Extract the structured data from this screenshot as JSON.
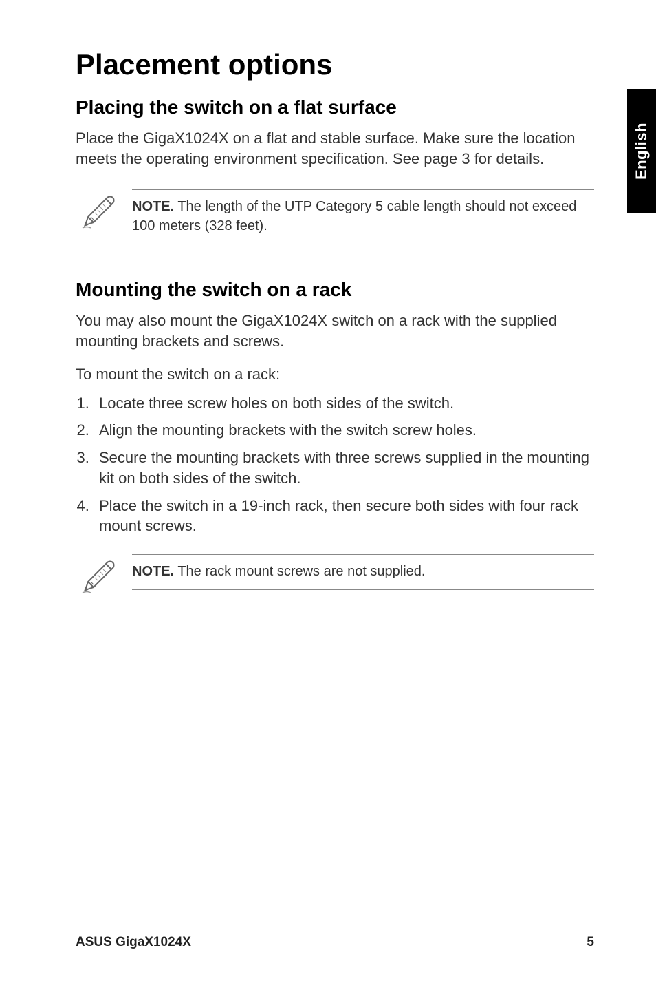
{
  "sideTab": "English",
  "title": "Placement options",
  "section1": {
    "heading": "Placing the switch on a flat surface",
    "paragraph": "Place the GigaX1024X on a flat and stable surface. Make sure the location meets the operating environment specification. See page 3 for details.",
    "noteLabel": "NOTE.",
    "noteText": " The length of the UTP Category 5 cable length should not exceed 100 meters (328 feet)."
  },
  "section2": {
    "heading": "Mounting the switch on a rack",
    "paragraph": "You may also mount the GigaX1024X switch on a rack with the supplied mounting brackets and screws.",
    "leadIn": "To mount the switch on a rack:",
    "steps": [
      "Locate three screw holes on both sides of the switch.",
      "Align the mounting brackets with the switch screw holes.",
      "Secure the mounting brackets with three screws supplied in the mounting kit on both sides of the switch.",
      "Place the switch in a 19-inch rack, then secure both sides with four rack mount screws."
    ],
    "noteLabel": "NOTE.",
    "noteText": " The rack mount screws are not supplied."
  },
  "footer": {
    "left": "ASUS GigaX1024X",
    "right": "5"
  }
}
